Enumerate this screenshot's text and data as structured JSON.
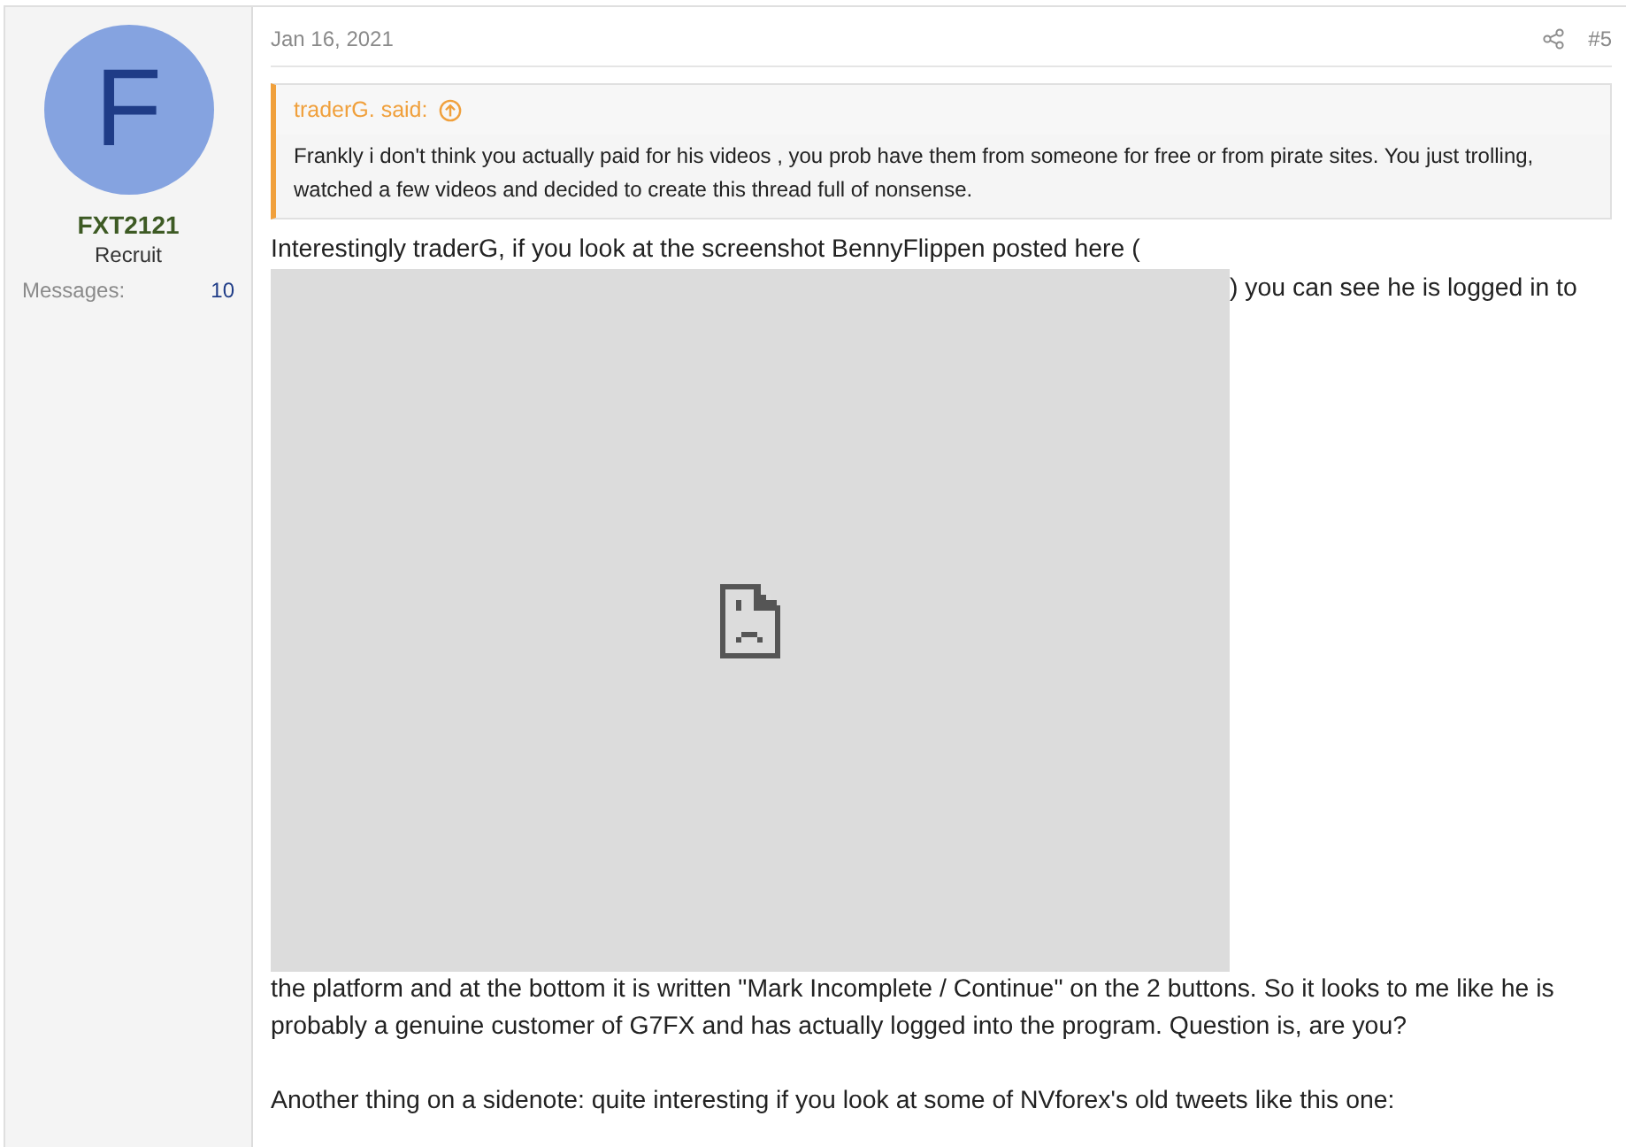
{
  "author": {
    "initial": "F",
    "name": "FXT2121",
    "title": "Recruit",
    "stats": [
      {
        "label": "Messages:",
        "value": "10"
      }
    ]
  },
  "post": {
    "date": "Jan 16, 2021",
    "number": "#5",
    "quote": {
      "author": "traderG. said:",
      "text": "Frankly i don't think you actually paid for his videos , you prob have them from someone for free or from pirate sites. You just trolling, watched a few videos and decided to create this thread full of nonsense."
    },
    "text_before_image": "Interestingly traderG, if you look at the screenshot BennyFlippen posted here (",
    "text_beside_image": ") you can see he is logged in to",
    "paragraphs": [
      "the platform and at the bottom it is written \"Mark Incomplete / Continue\" on the 2 buttons. So it looks to me like he is probably a genuine customer of G7FX and has actually logged into the program. Question is, are you?",
      "Another thing on a sidenote: quite interesting if you look at some of NVforex's old tweets like this one:"
    ]
  }
}
